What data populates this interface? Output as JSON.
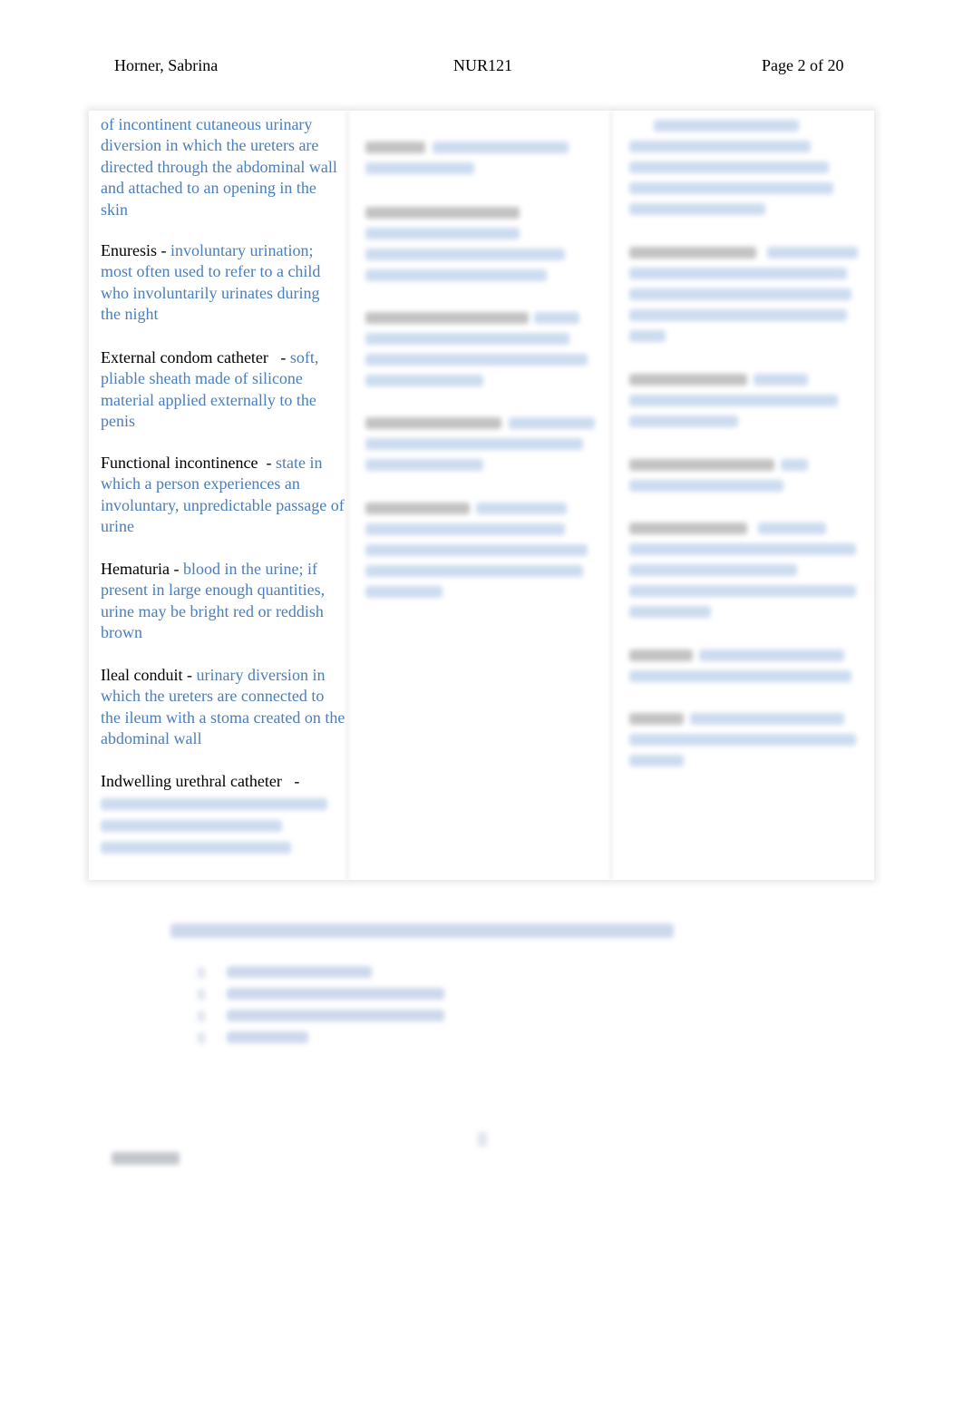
{
  "header": {
    "author": "Horner, Sabrina",
    "course": "NUR121",
    "page_label": "Page 2 of 20"
  },
  "glossary": {
    "column1": [
      {
        "term": "",
        "definition": "of incontinent cutaneous urinary diversion in which the ureters are directed through the abdominal wall and attached to an opening in the skin"
      },
      {
        "term": "Enuresis",
        "definition": "involuntary urination; most often used to refer to a child who involuntarily urinates during the night"
      },
      {
        "term": "External condom catheter",
        "definition": "soft, pliable sheath made of silicone material applied externally to the penis"
      },
      {
        "term": "Functional incontinence",
        "definition": "state in which a person experiences an involuntary, unpredictable passage of urine"
      },
      {
        "term": "Hematuria",
        "definition": "blood in the urine; if present in large enough quantities, urine may be bright red or reddish brown"
      },
      {
        "term": "Ileal conduit",
        "definition": "urinary diversion in which the ureters are connected to the ileum with a stoma created on the abdominal wall"
      },
      {
        "term": "Indwelling urethral catheter",
        "definition": ""
      }
    ],
    "separator": "-",
    "blurred_note": "remaining content obscured (blurred)"
  },
  "colors": {
    "term": "#000000",
    "definition": "#4a7ebb"
  }
}
